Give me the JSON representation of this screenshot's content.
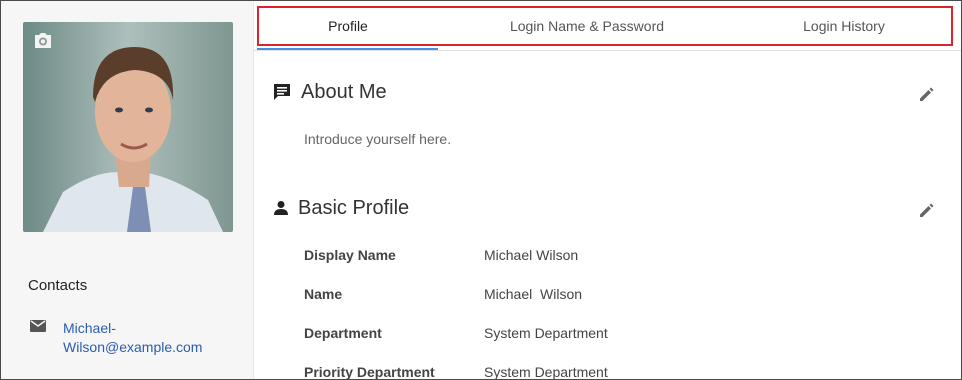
{
  "sidebar": {
    "photo_alt": "profile-photo",
    "camera_icon": "camera-icon",
    "contacts_title": "Contacts",
    "email_icon": "mail-icon",
    "email": "Michael-Wilson@example.com",
    "email_line1": "Michael-",
    "email_line2": "Wilson@example.com"
  },
  "tabs": [
    {
      "label": "Profile",
      "active": true
    },
    {
      "label": "Login Name & Password",
      "active": false
    },
    {
      "label": "Login History",
      "active": false
    }
  ],
  "about": {
    "title": "About Me",
    "placeholder": "Introduce yourself here."
  },
  "basic_profile": {
    "title": "Basic Profile",
    "fields": [
      {
        "label": "Display Name",
        "value": "Michael Wilson"
      },
      {
        "label": "Name",
        "value": "Michael  Wilson"
      },
      {
        "label": "Department",
        "value": "System Department"
      },
      {
        "label": "Priority Department",
        "value": "System Department"
      }
    ]
  },
  "colors": {
    "accent": "#4a90e2",
    "highlight_border": "#d9232d",
    "link": "#2a5db0"
  }
}
